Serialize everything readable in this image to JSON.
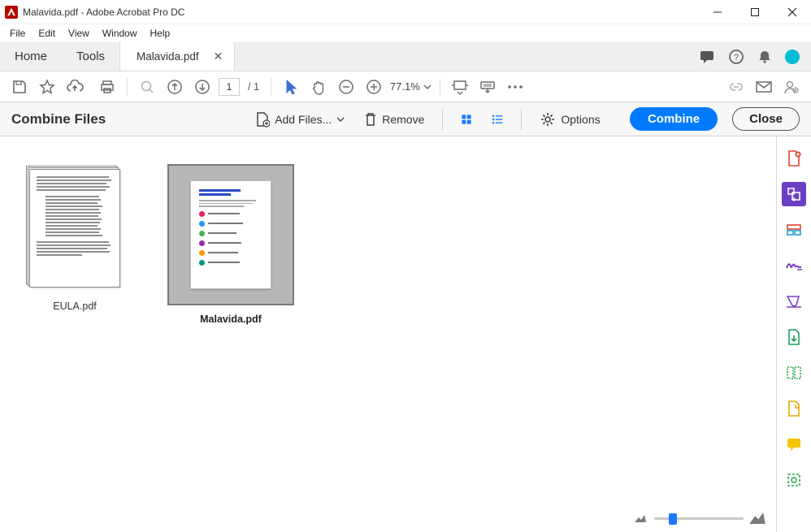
{
  "window": {
    "title": "Malavida.pdf - Adobe Acrobat Pro DC"
  },
  "menu": {
    "items": [
      "File",
      "Edit",
      "View",
      "Window",
      "Help"
    ]
  },
  "tabs": {
    "home_label": "Home",
    "tools_label": "Tools",
    "doc_label": "Malavida.pdf"
  },
  "toolbar": {
    "page_current": "1",
    "page_total": "/  1",
    "zoom_level": "77.1%"
  },
  "combine": {
    "title": "Combine Files",
    "add_files_label": "Add Files...",
    "remove_label": "Remove",
    "options_label": "Options",
    "combine_button": "Combine",
    "close_button": "Close"
  },
  "files": [
    {
      "name": "EULA.pdf",
      "selected": false
    },
    {
      "name": "Malavida.pdf",
      "selected": true
    }
  ]
}
